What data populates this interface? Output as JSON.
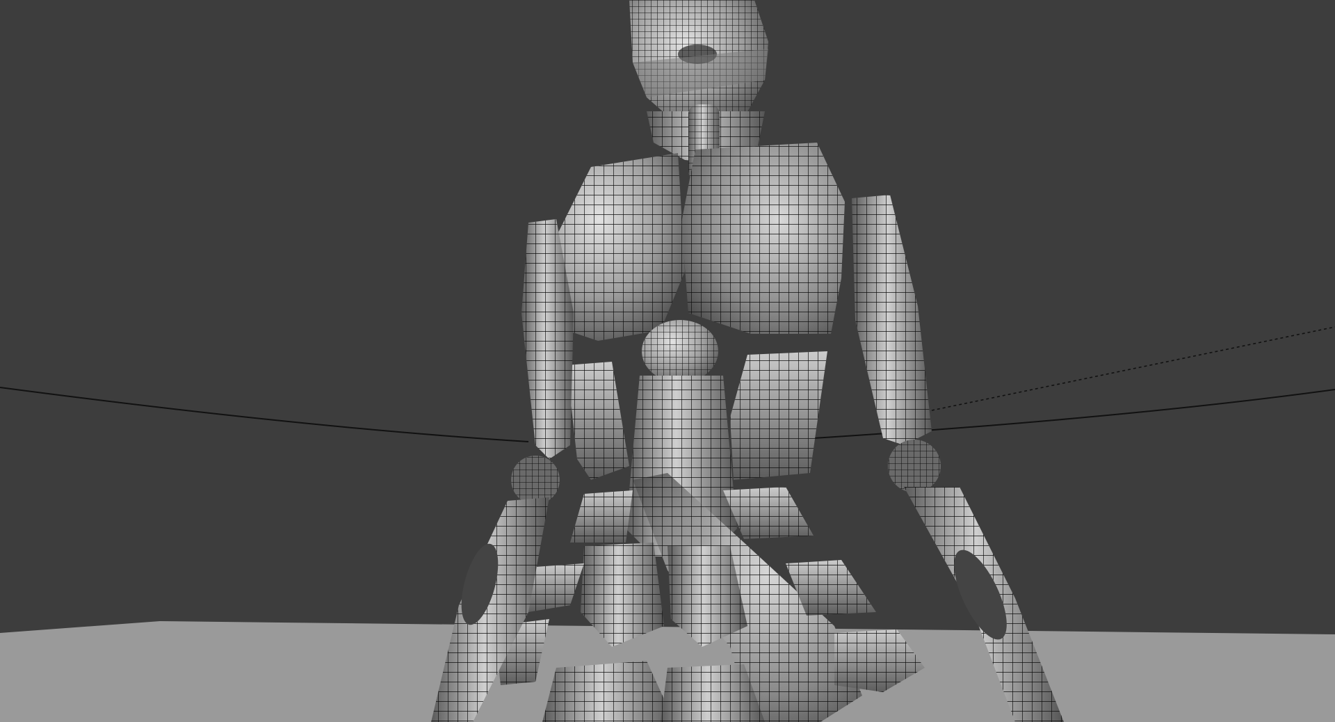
{
  "viewport": {
    "background_color": "#3d3d3d",
    "floor_color": "#9a9a9a",
    "wire_color": "#111111",
    "shade_light": "#d9d9d9",
    "shade_dark": "#555555"
  },
  "scene": {
    "display_mode": "smooth-shaded-with-wireframe",
    "objects": [
      "character-mesh",
      "ground-plane",
      "curve-left",
      "curve-right",
      "dashed-guide-line"
    ]
  }
}
